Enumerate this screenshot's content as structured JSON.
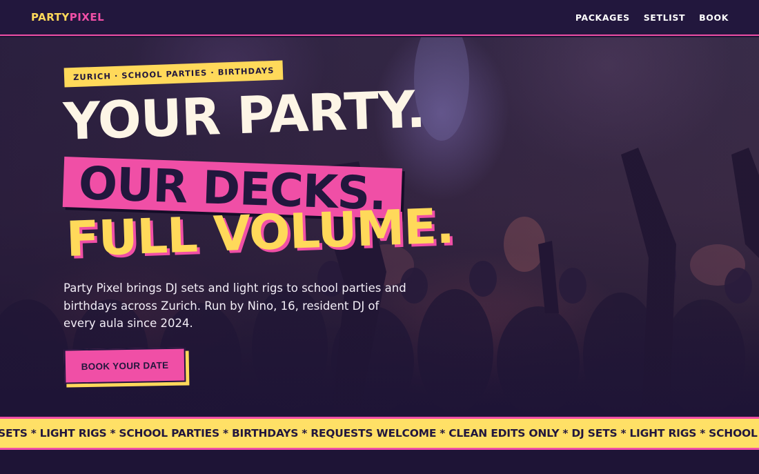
{
  "brand": {
    "part1": "PARTY",
    "part2": "PIXEL"
  },
  "nav": [
    {
      "label": "PACKAGES"
    },
    {
      "label": "SETLIST"
    },
    {
      "label": "BOOK"
    }
  ],
  "hero": {
    "tag": "ZURICH · SCHOOL PARTIES · BIRTHDAYS",
    "headline": [
      "YOUR PARTY.",
      "OUR DECKS.",
      "FULL VOLUME."
    ],
    "lede": "Party Pixel brings DJ sets and light rigs to school parties and birthdays across Zurich. Run by Nino, 16, resident DJ of every aula since 2024.",
    "cta": "BOOK YOUR DATE"
  },
  "ticker": {
    "separator": "*",
    "items": [
      "SETS",
      "LIGHT RIGS",
      "SCHOOL PARTIES",
      "BIRTHDAYS",
      "REQUESTS WELCOME",
      "CLEAN EDITS ONLY",
      "DJ SETS",
      "LIGHT RIGS",
      "SCHOOL PARTIES"
    ]
  },
  "colors": {
    "background": "#1e1436",
    "pink": "#f04fa6",
    "yellow": "#ffd95a",
    "cream": "#fdf5e6"
  }
}
